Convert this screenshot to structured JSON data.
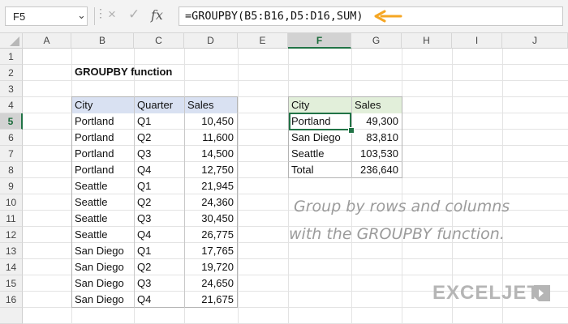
{
  "name_box": {
    "value": "F5"
  },
  "formula_bar": {
    "cancel_icon": "×",
    "enter_icon": "✓",
    "fx_label": "fx",
    "formula": "=GROUPBY(B5:B16,D5:D16,SUM)",
    "arrow_color": "#f5a623"
  },
  "columns": [
    "A",
    "B",
    "C",
    "D",
    "E",
    "F",
    "G",
    "H",
    "I",
    "J"
  ],
  "rows": [
    "1",
    "2",
    "3",
    "4",
    "5",
    "6",
    "7",
    "8",
    "9",
    "10",
    "11",
    "12",
    "13",
    "14",
    "15",
    "16"
  ],
  "selected_cell": {
    "column": "F",
    "row": "5"
  },
  "title": "GROUPBY function",
  "source_table": {
    "headers": [
      "City",
      "Quarter",
      "Sales"
    ],
    "rows": [
      [
        "Portland",
        "Q1",
        "10,450"
      ],
      [
        "Portland",
        "Q2",
        "11,600"
      ],
      [
        "Portland",
        "Q3",
        "14,500"
      ],
      [
        "Portland",
        "Q4",
        "12,750"
      ],
      [
        "Seattle",
        "Q1",
        "21,945"
      ],
      [
        "Seattle",
        "Q2",
        "24,360"
      ],
      [
        "Seattle",
        "Q3",
        "30,450"
      ],
      [
        "Seattle",
        "Q4",
        "26,775"
      ],
      [
        "San Diego",
        "Q1",
        "17,765"
      ],
      [
        "San Diego",
        "Q2",
        "19,720"
      ],
      [
        "San Diego",
        "Q3",
        "24,650"
      ],
      [
        "San Diego",
        "Q4",
        "21,675"
      ]
    ],
    "header_color": "#d9e1f2"
  },
  "result_table": {
    "headers": [
      "City",
      "Sales"
    ],
    "rows": [
      [
        "Portland",
        "49,300"
      ],
      [
        "San Diego",
        "83,810"
      ],
      [
        "Seattle",
        "103,530"
      ],
      [
        "Total",
        "236,640"
      ]
    ],
    "header_color": "#e2efda"
  },
  "caption": {
    "line1": "Group by rows and columns",
    "line2": "with the GROUPBY function."
  },
  "logo": {
    "text": "EXCELJET"
  },
  "colors": {
    "accent_green": "#217346"
  }
}
